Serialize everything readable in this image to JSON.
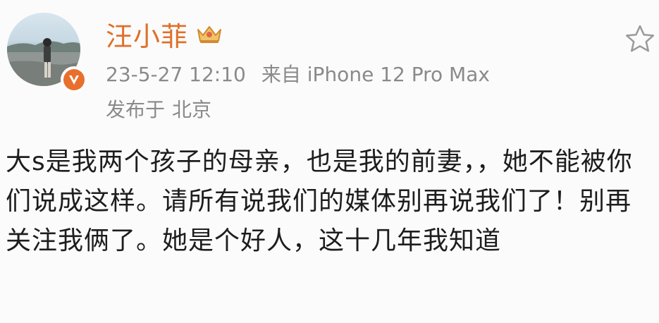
{
  "post": {
    "username": "汪小菲",
    "timestamp": "23-5-27 12:10",
    "source": "来自 iPhone 12 Pro Max",
    "location_prefix": "发布于",
    "location": "北京",
    "content": "大s是我两个孩子的母亲，也是我的前妻，，她不能被你们说成这样。请所有说我们的媒体别再说我们了！别再关注我俩了。她是个好人，这十几年我知道"
  },
  "icons": {
    "crown": "crown-icon",
    "verified": "verified-badge-icon",
    "favorite": "star-outline-icon"
  },
  "colors": {
    "username": "#e0702a",
    "meta": "#8a8a8a",
    "badge": "#e8702c",
    "crown": "#e2a440"
  }
}
